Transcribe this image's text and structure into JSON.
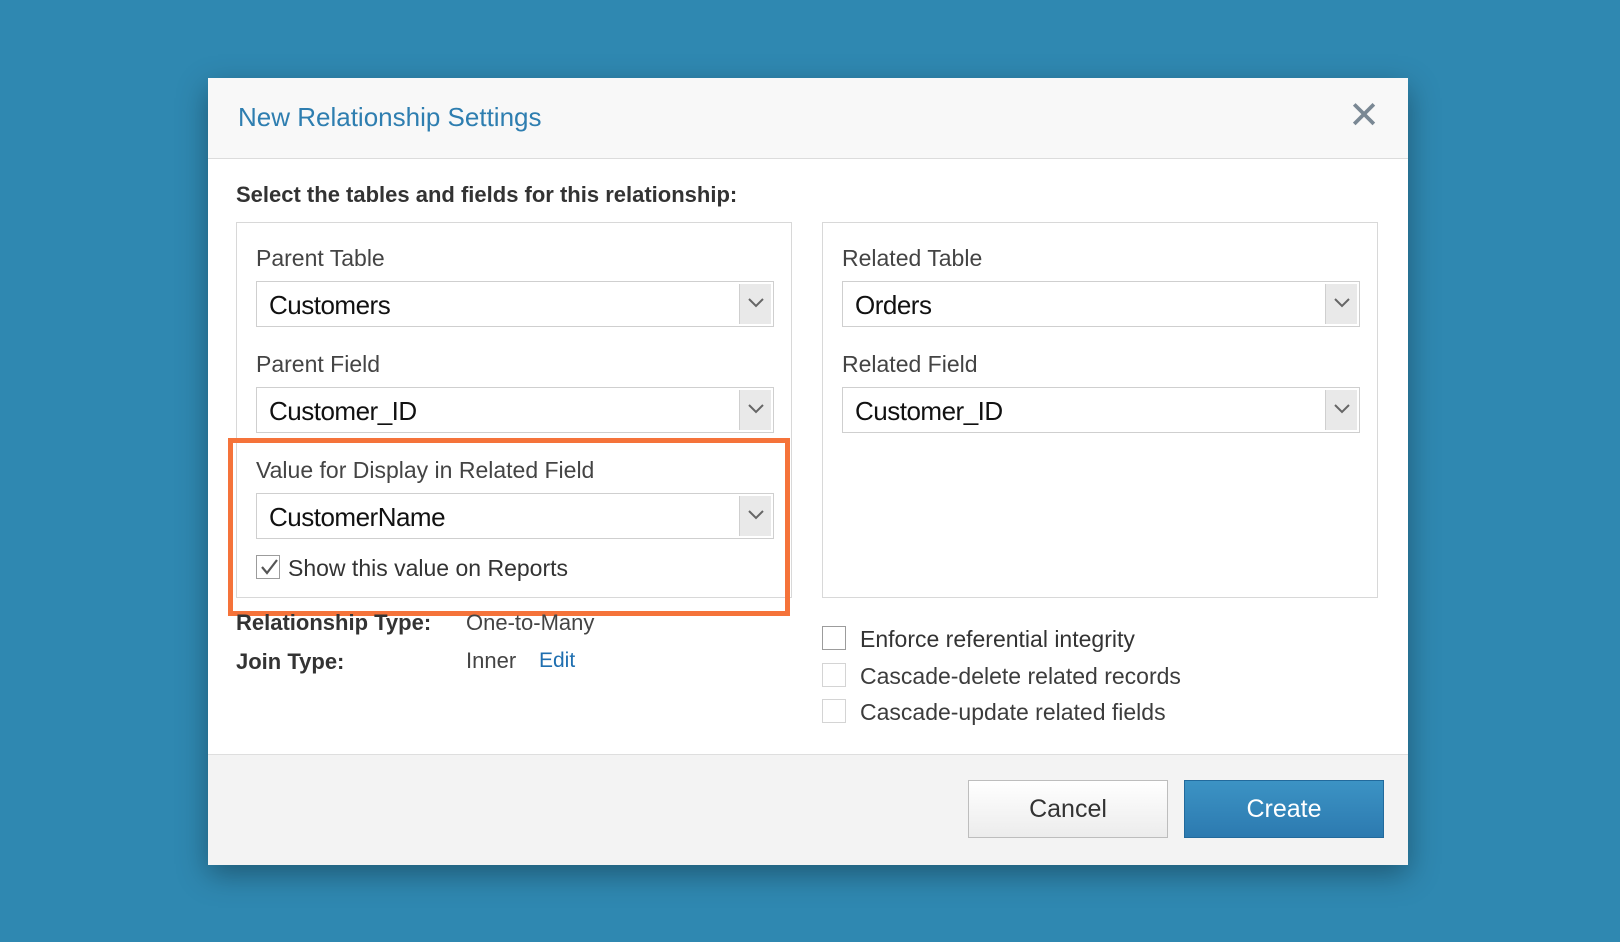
{
  "dialog": {
    "title": "New Relationship Settings",
    "close_glyph": "✕",
    "instructions": "Select the tables and fields for this relationship:"
  },
  "parent": {
    "table_label": "Parent Table",
    "table_value": "Customers",
    "field_label": "Parent Field",
    "field_value": "Customer_ID",
    "display_label": "Value for Display in Related Field",
    "display_value": "CustomerName",
    "show_on_reports_label": "Show this value on Reports",
    "show_on_reports_checked": true
  },
  "related": {
    "table_label": "Related Table",
    "table_value": "Orders",
    "field_label": "Related Field",
    "field_value": "Customer_ID"
  },
  "relationship": {
    "type_label": "Relationship Type:",
    "type_value": "One-to-Many",
    "join_label": "Join Type:",
    "join_value": "Inner",
    "edit_link": "Edit"
  },
  "options": {
    "enforce_label": "Enforce referential integrity",
    "enforce_checked": false,
    "cascade_delete_label": "Cascade-delete related records",
    "cascade_delete_checked": false,
    "cascade_update_label": "Cascade-update related fields",
    "cascade_update_checked": false
  },
  "footer": {
    "cancel_label": "Cancel",
    "create_label": "Create"
  },
  "colors": {
    "background": "#2f88b1",
    "accent": "#2e7eb0",
    "highlight": "#f5733a",
    "primary_button": "#2c7ab0"
  },
  "icons": {
    "close": "close-icon",
    "dropdown": "chevron-down-icon",
    "check": "checkmark-icon"
  }
}
